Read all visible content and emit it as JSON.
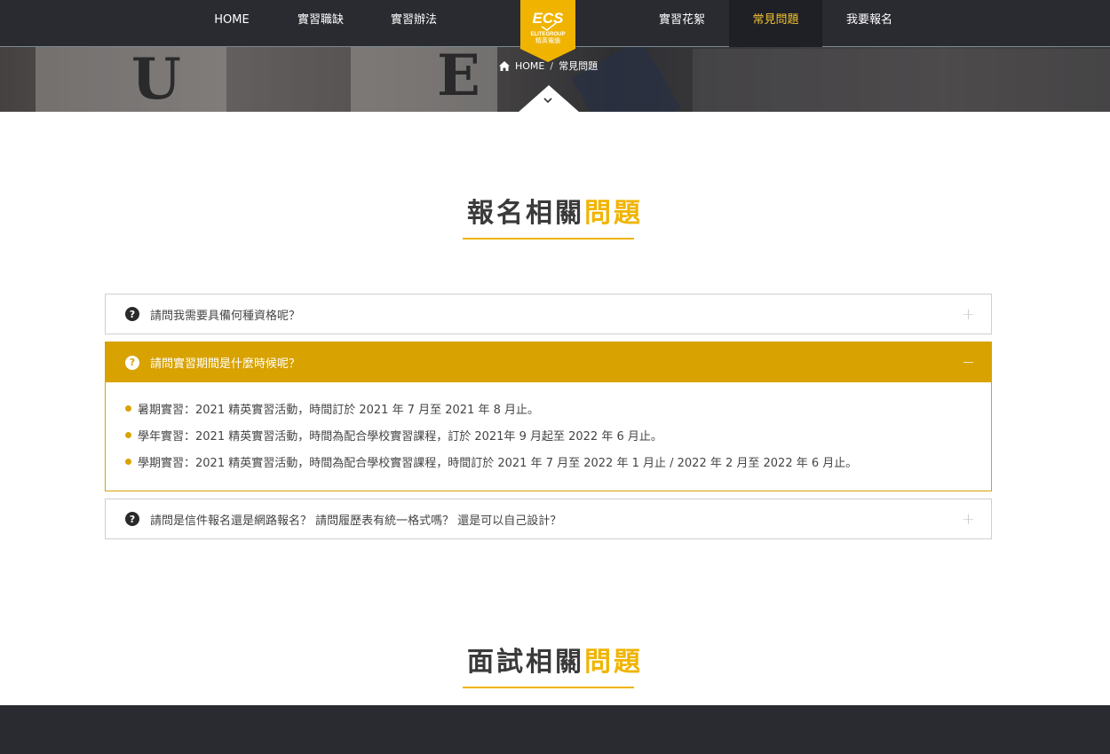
{
  "nav": {
    "items": [
      {
        "label": "HOME"
      },
      {
        "label": "實習職缺"
      },
      {
        "label": "實習辦法"
      },
      {
        "label": "實習花絮"
      },
      {
        "label": "常見問題"
      },
      {
        "label": "我要報名"
      }
    ],
    "active_index": 4,
    "logo": {
      "brand": "ECS",
      "sub": "ELITEGROUP",
      "cn": "精英電腦"
    }
  },
  "hero": {
    "glyph_1": "U",
    "glyph_2": "E"
  },
  "breadcrumb": {
    "home": "HOME",
    "separator": "/",
    "current": "常見問題"
  },
  "sections": [
    {
      "title_main": "報名相關",
      "title_highlight": "問題"
    },
    {
      "title_main": "面試相關",
      "title_highlight": "問題"
    }
  ],
  "faq": [
    {
      "question": "請問我需要具備何種資格呢？",
      "expanded": false,
      "toggle": "+"
    },
    {
      "question": "請問實習期間是什麼時候呢？",
      "expanded": true,
      "toggle": "−",
      "answers": [
        "暑期實習：2021 精英實習活動，時間訂於 2021 年 7 月至 2021 年 8 月止。",
        "學年實習：2021 精英實習活動，時間為配合學校實習課程，訂於 2021年 9 月起至 2022 年 6 月止。",
        "學期實習：2021 精英實習活動，時間為配合學校實習課程，時間訂於 2021 年 7 月至 2022 年 1 月止 / 2022 年 2 月至 2022 年 6 月止。"
      ]
    },
    {
      "question": "請問是信件報名還是網路報名？ 請問履歷表有統一格式嗎？ 還是可以自己設計？",
      "expanded": false,
      "toggle": "+"
    }
  ],
  "colors": {
    "accent": "#d8a200",
    "title_highlight": "#f0b400",
    "nav_bg": "#2a2b31",
    "active_text": "#f1c232"
  },
  "icons": {
    "faq": "question-circle-icon",
    "home": "home-icon",
    "down": "chevron-down-icon"
  }
}
